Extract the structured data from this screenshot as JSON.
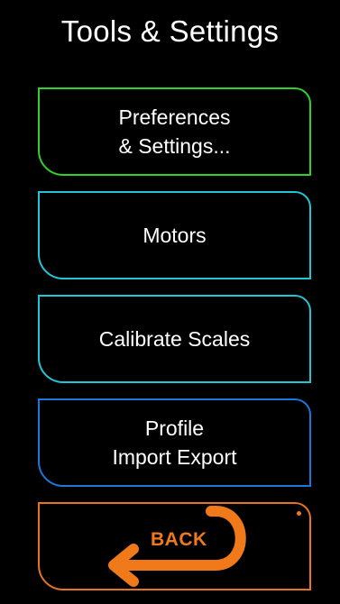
{
  "header": {
    "title": "Tools & Settings"
  },
  "buttons": {
    "preferences": {
      "label": "Preferences\n& Settings..."
    },
    "motors": {
      "label": "Motors"
    },
    "calibrate": {
      "label": "Calibrate Scales"
    },
    "profile": {
      "label": "Profile\nImport Export"
    },
    "back": {
      "label": "BACK",
      "icon": "back-arrow-icon"
    }
  },
  "colors": {
    "background": "#000000",
    "preferences_border": "#2fd12f",
    "motors_border": "#1fc6d6",
    "calibrate_border": "#1fc6d6",
    "profile_border": "#1a78d8",
    "back_accent": "#f07a1a"
  }
}
